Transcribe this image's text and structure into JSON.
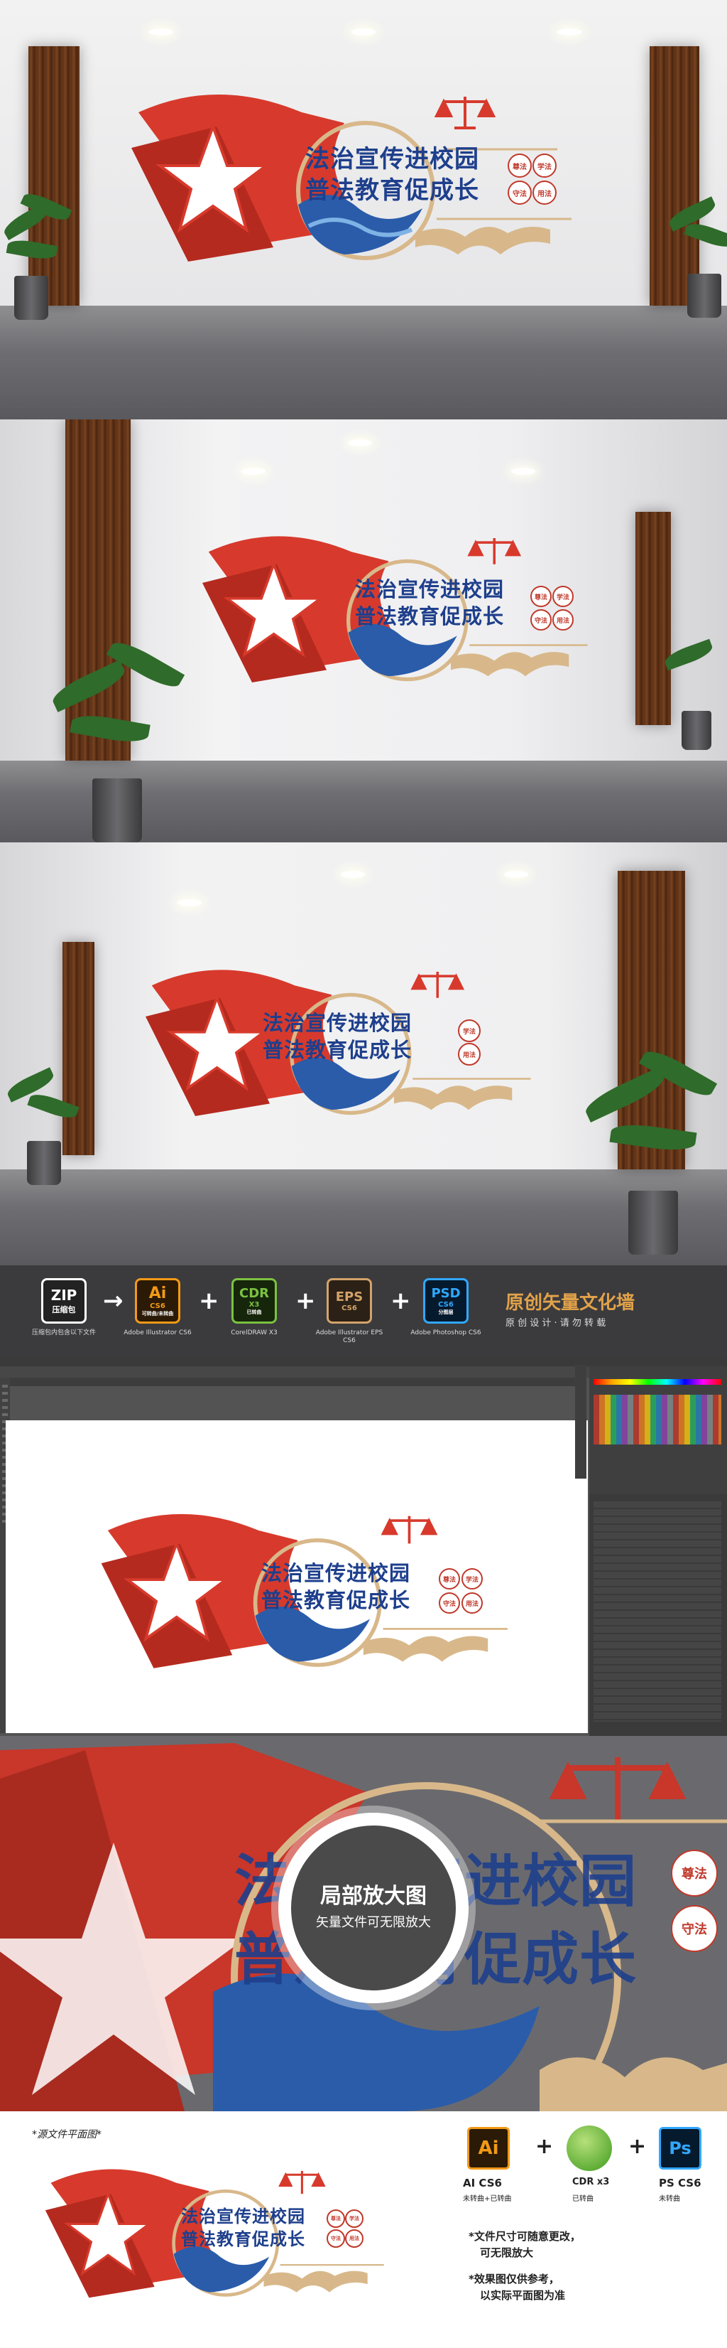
{
  "sign": {
    "line1": "法治宣传进校园",
    "line2": "普法教育促成长",
    "badges": [
      "尊法",
      "学法",
      "守法",
      "用法"
    ]
  },
  "formats": {
    "zip_label": "ZIP",
    "zip_sub": "压缩包",
    "zip_caption": "压缩包内包含以下文件",
    "ai": {
      "label": "Ai",
      "sub": "CS6",
      "note": "可转曲/未转曲",
      "caption": "Adobe Illustrator CS6"
    },
    "cdr": {
      "label": "CDR",
      "sub": "X3",
      "note": "已转曲",
      "caption": "CorelDRAW X3"
    },
    "eps": {
      "label": "EPS",
      "sub": "CS6",
      "caption": "Adobe Illustrator EPS CS6"
    },
    "psd": {
      "label": "PSD",
      "sub": "CS6",
      "note": "分图层",
      "caption": "Adobe Photoshop CS6"
    },
    "slogan": "原创矢量文化墙",
    "slogan_sub": "原 创 设 计 · 请 勿 转 载"
  },
  "zoom": {
    "title": "局部放大图",
    "subtitle": "矢量文件可无限放大"
  },
  "bottom": {
    "plan_label": "*源文件平面图*",
    "ai": {
      "label": "Ai",
      "name": "AI CS6",
      "desc": "未转曲+已转曲"
    },
    "cdr": {
      "name": "CDR x3",
      "desc": "已转曲"
    },
    "ps": {
      "label": "Ps",
      "name": "PS CS6",
      "desc": "未转曲"
    },
    "note1": "*文件尺寸可随意更改，",
    "note1b": "可无限放大",
    "note2": "*效果图仅供参考，",
    "note2b": "以实际平面图为准"
  },
  "colors": {
    "red": "#d73a2c",
    "blue": "#1e3f8c",
    "gold": "#d8b88a"
  }
}
